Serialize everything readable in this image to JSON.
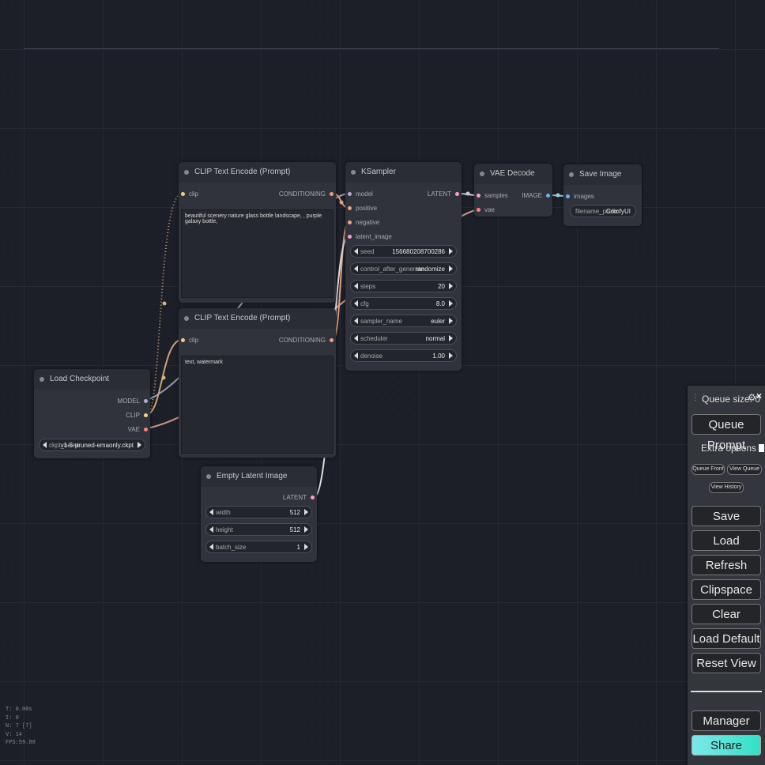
{
  "nodes": {
    "clip_pos": {
      "title": "CLIP Text Encode (Prompt)",
      "input_clip": "clip",
      "output": "CONDITIONING",
      "text": "beautiful scenery nature glass bottle landscape, , purple galaxy bottle,"
    },
    "clip_neg": {
      "title": "CLIP Text Encode (Prompt)",
      "input_clip": "clip",
      "output": "CONDITIONING",
      "text": "text, watermark"
    },
    "ksampler": {
      "title": "KSampler",
      "inputs": [
        "model",
        "positive",
        "negative",
        "latent_image"
      ],
      "output": "LATENT",
      "widgets": [
        {
          "label": "seed",
          "value": "156680208700286"
        },
        {
          "label": "control_after_generate",
          "value": "randomize"
        },
        {
          "label": "steps",
          "value": "20"
        },
        {
          "label": "cfg",
          "value": "8.0"
        },
        {
          "label": "sampler_name",
          "value": "euler"
        },
        {
          "label": "scheduler",
          "value": "normal"
        },
        {
          "label": "denoise",
          "value": "1.00"
        }
      ]
    },
    "vae_decode": {
      "title": "VAE Decode",
      "inputs": [
        "samples",
        "vae"
      ],
      "output": "IMAGE"
    },
    "save_image": {
      "title": "Save Image",
      "input": "images",
      "widget_label": "filename_prefix",
      "widget_value": "ComfyUI"
    },
    "load_checkpoint": {
      "title": "Load Checkpoint",
      "outputs": [
        "MODEL",
        "CLIP",
        "VAE"
      ],
      "widget_label": "ckpt_name",
      "widget_value": "v1-5-pruned-emaonly.ckpt"
    },
    "empty_latent": {
      "title": "Empty Latent Image",
      "output": "LATENT",
      "widgets": [
        {
          "label": "width",
          "value": "512"
        },
        {
          "label": "height",
          "value": "512"
        },
        {
          "label": "batch_size",
          "value": "1"
        }
      ]
    }
  },
  "stats": [
    "T: 0.00s",
    "I: 0",
    "N: 7 [7]",
    "V: 14",
    "FPS:59.88"
  ],
  "menu": {
    "queue_size": "Queue size: 0",
    "queue_prompt": "Queue Prompt",
    "extra_options": "Extra options",
    "queue_front": "Queue Front",
    "view_queue": "View Queue",
    "view_history": "View History",
    "save": "Save",
    "load": "Load",
    "refresh": "Refresh",
    "clipspace": "Clipspace",
    "clear": "Clear",
    "load_default": "Load Default",
    "reset_view": "Reset View",
    "manager": "Manager",
    "share": "Share"
  }
}
